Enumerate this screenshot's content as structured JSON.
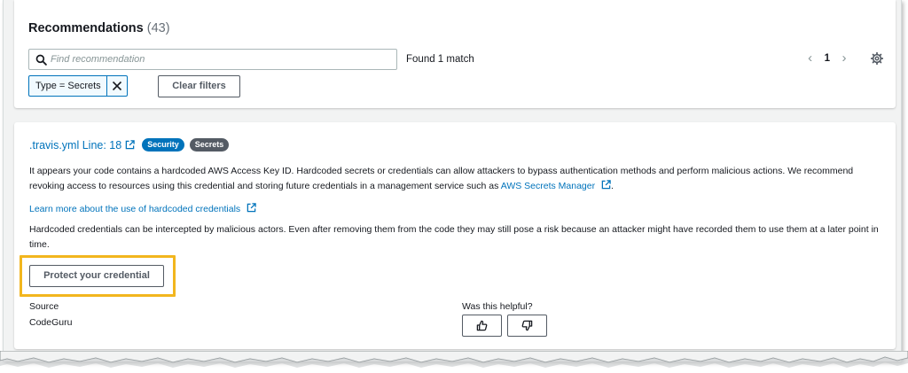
{
  "recommendations": {
    "title": "Recommendations",
    "count": "(43)",
    "search": {
      "placeholder": "Find recommendation",
      "value": ""
    },
    "match_text": "Found 1 match",
    "pager": {
      "prev": "‹",
      "page": "1",
      "next": "›"
    },
    "filter": {
      "label": "Type = Secrets"
    },
    "clear_filters_label": "Clear filters"
  },
  "card": {
    "file_link": ".travis.yml Line: 18",
    "badges": [
      "Security",
      "Secrets"
    ],
    "description_1": "It appears your code contains a hardcoded AWS Access Key ID. Hardcoded secrets or credentials can allow attackers to bypass authentication methods and perform malicious actions. We recommend revoking access to resources using this credential and storing future credentials in a management service such as",
    "secrets_manager_link": "AWS Secrets Manager",
    "description_1_end": ".",
    "learn_more_link": "Learn more about the use of hardcoded credentials",
    "description_2": "Hardcoded credentials can be intercepted by malicious actors. Even after removing them from the code they may still pose a risk because an attacker might have recorded them to use them at a later point in time.",
    "protect_button_label": "Protect your credential",
    "source_label": "Source",
    "source_value": "CodeGuru",
    "helpful_label": "Was this helpful?"
  },
  "colors": {
    "accent": "#0073bb",
    "highlight": "#f2b61e",
    "badge_secrets": "#545b64",
    "background": "#f2f3f3"
  },
  "icons": [
    "search-icon",
    "gear-icon",
    "close-icon",
    "external-link-icon",
    "thumbs-up-icon",
    "thumbs-down-icon",
    "chevron-left-icon",
    "chevron-right-icon"
  ]
}
